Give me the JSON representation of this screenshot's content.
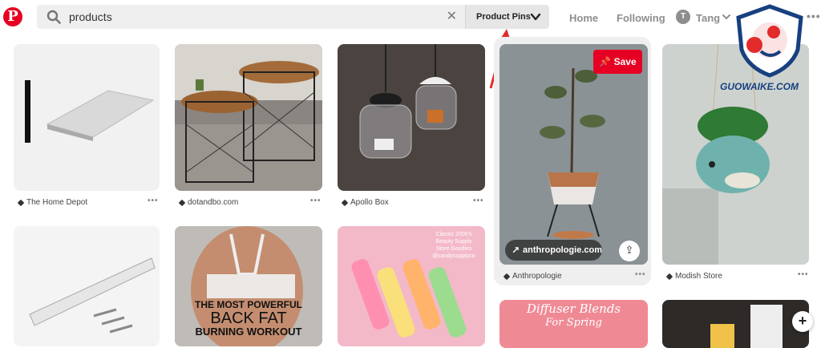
{
  "header": {
    "logo_letter": "P",
    "search_value": "products",
    "filter_label": "Product Pins",
    "nav": {
      "home": "Home",
      "following": "Following",
      "user": "Tang",
      "avatar_initial": "T"
    }
  },
  "pins": [
    {
      "source": "The Home Depot"
    },
    {
      "source": "dotandbo.com"
    },
    {
      "source": "Apollo Box"
    },
    {
      "source": "Anthropologie",
      "link": "anthropologie.com",
      "save_label": "Save"
    },
    {
      "source": "Modish Store"
    }
  ],
  "overlays": {
    "back_fat_lines": [
      "THE MOST POWERFUL",
      "BACK FAT",
      "BURNING WORKOUT"
    ],
    "diffuser_lines": [
      "Diffuser Blends",
      "For Spring"
    ],
    "lipgloss_text": [
      "Classic 2000's",
      "Beauty Supply",
      "Store Goodies",
      "@candysupplyco"
    ]
  },
  "watermark": "GUOWAIKE.COM",
  "colors": {
    "brand": "#e60023",
    "watermark": "#17407f"
  }
}
